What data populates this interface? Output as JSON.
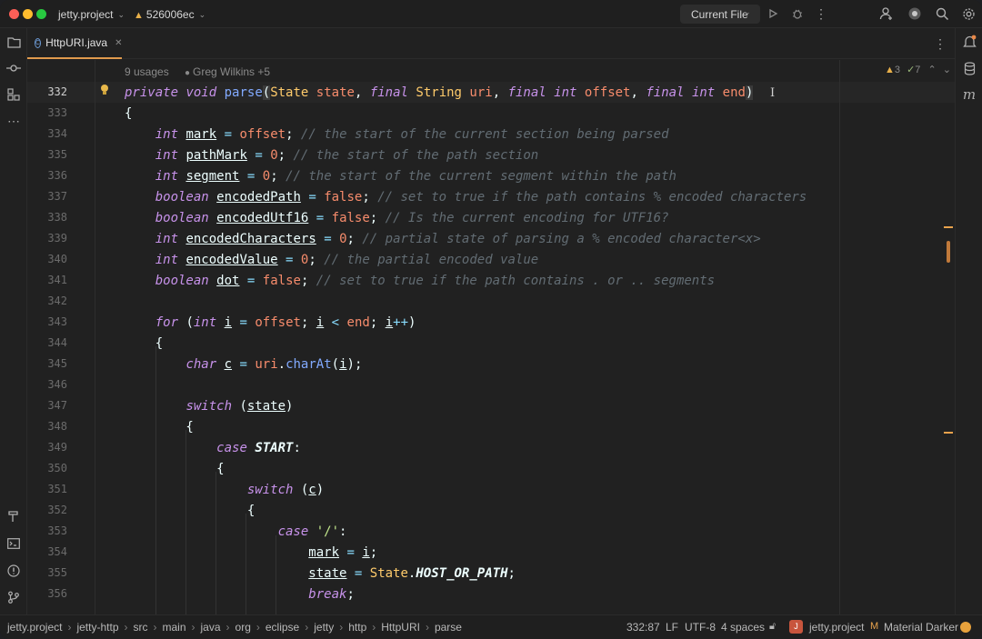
{
  "titlebar": {
    "project": "jetty.project",
    "branch": "526006ec",
    "run_config": "Current File"
  },
  "tab": {
    "label": "HttpURI.java"
  },
  "editor": {
    "usages": "9 usages",
    "authors": "Greg Wilkins +5",
    "warnings": "3",
    "checks": "7"
  },
  "line_numbers": [
    "332",
    "333",
    "334",
    "335",
    "336",
    "337",
    "338",
    "339",
    "340",
    "341",
    "342",
    "343",
    "344",
    "345",
    "346",
    "347",
    "348",
    "349",
    "350",
    "351",
    "352",
    "353",
    "354",
    "355",
    "356"
  ],
  "statusbar": {
    "breadcrumbs": [
      "jetty.project",
      "jetty-http",
      "src",
      "main",
      "java",
      "org",
      "eclipse",
      "jetty",
      "http",
      "HttpURI",
      "parse"
    ],
    "position": "332:87",
    "line_sep": "LF",
    "encoding": "UTF-8",
    "indent": "4 spaces",
    "project": "jetty.project",
    "theme": "Material Darker"
  },
  "colors": {
    "accent": "#e09a4d",
    "keyword": "#c792ea",
    "type": "#ffcb6b",
    "number": "#f78c6c",
    "comment": "#626c73"
  }
}
